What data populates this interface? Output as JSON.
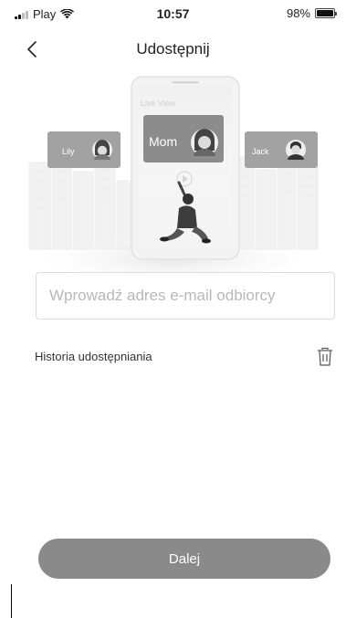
{
  "status_bar": {
    "carrier": "Play",
    "time": "10:57",
    "battery_percent": "98%",
    "battery_level": 0.98,
    "signal_icon": "cellular-signal-icon",
    "wifi_icon": "wifi-icon",
    "battery_icon": "battery-icon"
  },
  "nav": {
    "title": "Udostępnij",
    "back_icon": "chevron-left-icon"
  },
  "illustration": {
    "screen_label": "Live View",
    "cards": [
      {
        "name": "Lily"
      },
      {
        "name": "Mom"
      },
      {
        "name": "Jack"
      }
    ]
  },
  "email": {
    "placeholder": "Wprowadź adres e-mail odbiorcy",
    "value": ""
  },
  "history": {
    "label": "Historia udostępniania",
    "delete_icon": "trash-icon"
  },
  "actions": {
    "next_label": "Dalej"
  },
  "colors": {
    "primary_button": "#8a8a8a",
    "text": "#222222",
    "placeholder": "#b8b8b8",
    "border": "#dcdcdc"
  }
}
